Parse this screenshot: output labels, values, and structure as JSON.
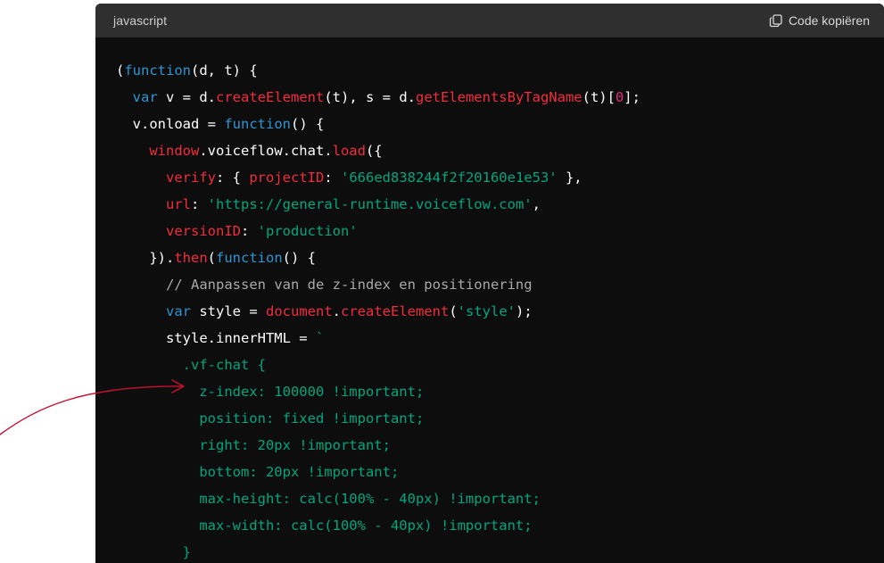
{
  "header": {
    "language": "javascript",
    "copy_label": "Code kopiëren",
    "copy_icon": "copy-icon"
  },
  "colors": {
    "keyword": "#2e95d3",
    "function": "#f22c3d",
    "string": "#00a67d",
    "comment": "#a9a9a9",
    "number": "#df3079",
    "plain": "#ffffff",
    "annotation_arrow": "#c8102e"
  },
  "code_lines": [
    [
      [
        "p",
        "("
      ],
      [
        "k",
        "function"
      ],
      [
        "p",
        "(d, t) {"
      ]
    ],
    [
      [
        "p",
        "  "
      ],
      [
        "k",
        "var"
      ],
      [
        "p",
        " v = d."
      ],
      [
        "f",
        "createElement"
      ],
      [
        "p",
        "(t), s = d."
      ],
      [
        "f",
        "getElementsByTagName"
      ],
      [
        "p",
        "(t)["
      ],
      [
        "n",
        "0"
      ],
      [
        "p",
        "];"
      ]
    ],
    [
      [
        "p",
        "  v.onload = "
      ],
      [
        "k",
        "function"
      ],
      [
        "p",
        "() {"
      ]
    ],
    [
      [
        "p",
        "    "
      ],
      [
        "f",
        "window"
      ],
      [
        "p",
        ".voiceflow.chat."
      ],
      [
        "f",
        "load"
      ],
      [
        "p",
        "({"
      ]
    ],
    [
      [
        "p",
        "      "
      ],
      [
        "f",
        "verify"
      ],
      [
        "p",
        ": { "
      ],
      [
        "f",
        "projectID"
      ],
      [
        "p",
        ": "
      ],
      [
        "s",
        "'666ed838244f2f20160e1e53'"
      ],
      [
        "p",
        " },"
      ]
    ],
    [
      [
        "p",
        "      "
      ],
      [
        "f",
        "url"
      ],
      [
        "p",
        ": "
      ],
      [
        "s",
        "'https://general-runtime.voiceflow.com'"
      ],
      [
        "p",
        ","
      ]
    ],
    [
      [
        "p",
        "      "
      ],
      [
        "f",
        "versionID"
      ],
      [
        "p",
        ": "
      ],
      [
        "s",
        "'production'"
      ]
    ],
    [
      [
        "p",
        "    })."
      ],
      [
        "f",
        "then"
      ],
      [
        "p",
        "("
      ],
      [
        "k",
        "function"
      ],
      [
        "p",
        "() {"
      ]
    ],
    [
      [
        "p",
        "      "
      ],
      [
        "c",
        "// Aanpassen van de z-index en positionering"
      ]
    ],
    [
      [
        "p",
        "      "
      ],
      [
        "k",
        "var"
      ],
      [
        "p",
        " style = "
      ],
      [
        "f",
        "document"
      ],
      [
        "p",
        "."
      ],
      [
        "f",
        "createElement"
      ],
      [
        "p",
        "("
      ],
      [
        "s",
        "'style'"
      ],
      [
        "p",
        ");"
      ]
    ],
    [
      [
        "p",
        "      style.innerHTML = "
      ],
      [
        "s",
        "`"
      ]
    ],
    [
      [
        "s",
        "        .vf-chat {"
      ]
    ],
    [
      [
        "s",
        "          z-index: 100000 !important;"
      ]
    ],
    [
      [
        "s",
        "          position: fixed !important;"
      ]
    ],
    [
      [
        "s",
        "          right: 20px !important;"
      ]
    ],
    [
      [
        "s",
        "          bottom: 20px !important;"
      ]
    ],
    [
      [
        "s",
        "          max-height: calc(100% - 40px) !important;"
      ]
    ],
    [
      [
        "s",
        "          max-width: calc(100% - 40px) !important;"
      ]
    ],
    [
      [
        "s",
        "        }"
      ]
    ]
  ]
}
